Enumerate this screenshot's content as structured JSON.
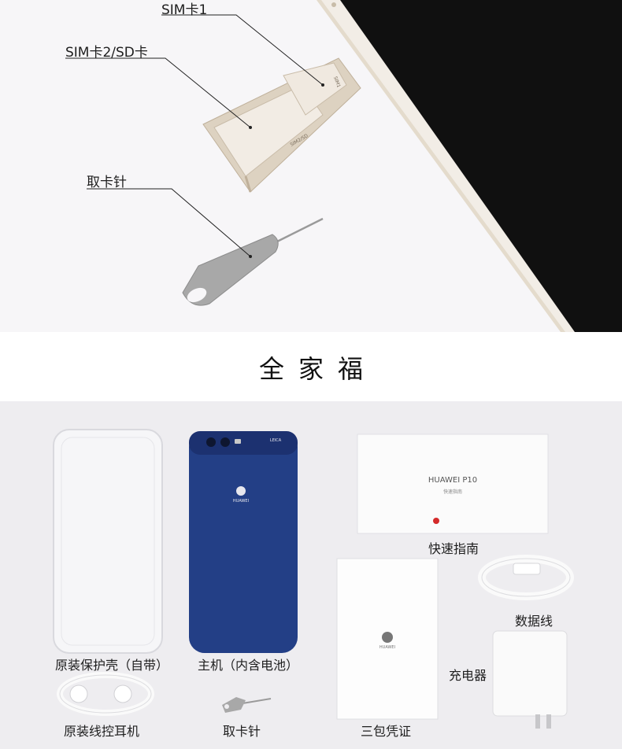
{
  "annotations": {
    "sim1": "SIM卡1",
    "sim2": "SIM卡2/SD卡",
    "eject_pin": "取卡针"
  },
  "tray_marks": {
    "sim1": "SIM1",
    "sim2": "SIM2/SD"
  },
  "section_title": "全家福",
  "phone_back": {
    "brand": "HUAWEI",
    "camera_brand": "LEICA"
  },
  "quick_guide": {
    "brand_model": "HUAWEI P10",
    "subtitle": "快速指南"
  },
  "warranty_card_brand": "HUAWEI",
  "items": {
    "case": "原装保护壳（自带）",
    "phone": "主机（内含电池）",
    "quick_guide": "快速指南",
    "cable": "数据线",
    "charger": "充电器",
    "earphones": "原装线控耳机",
    "eject_pin": "取卡针",
    "warranty": "三包凭证"
  },
  "colors": {
    "top_bg": "#f7f6f8",
    "bottom_bg": "#eeedf0",
    "tray_gold": "#ddd2c1",
    "phone_blue": "#233f86",
    "pin_gray": "#a8a8a8"
  }
}
